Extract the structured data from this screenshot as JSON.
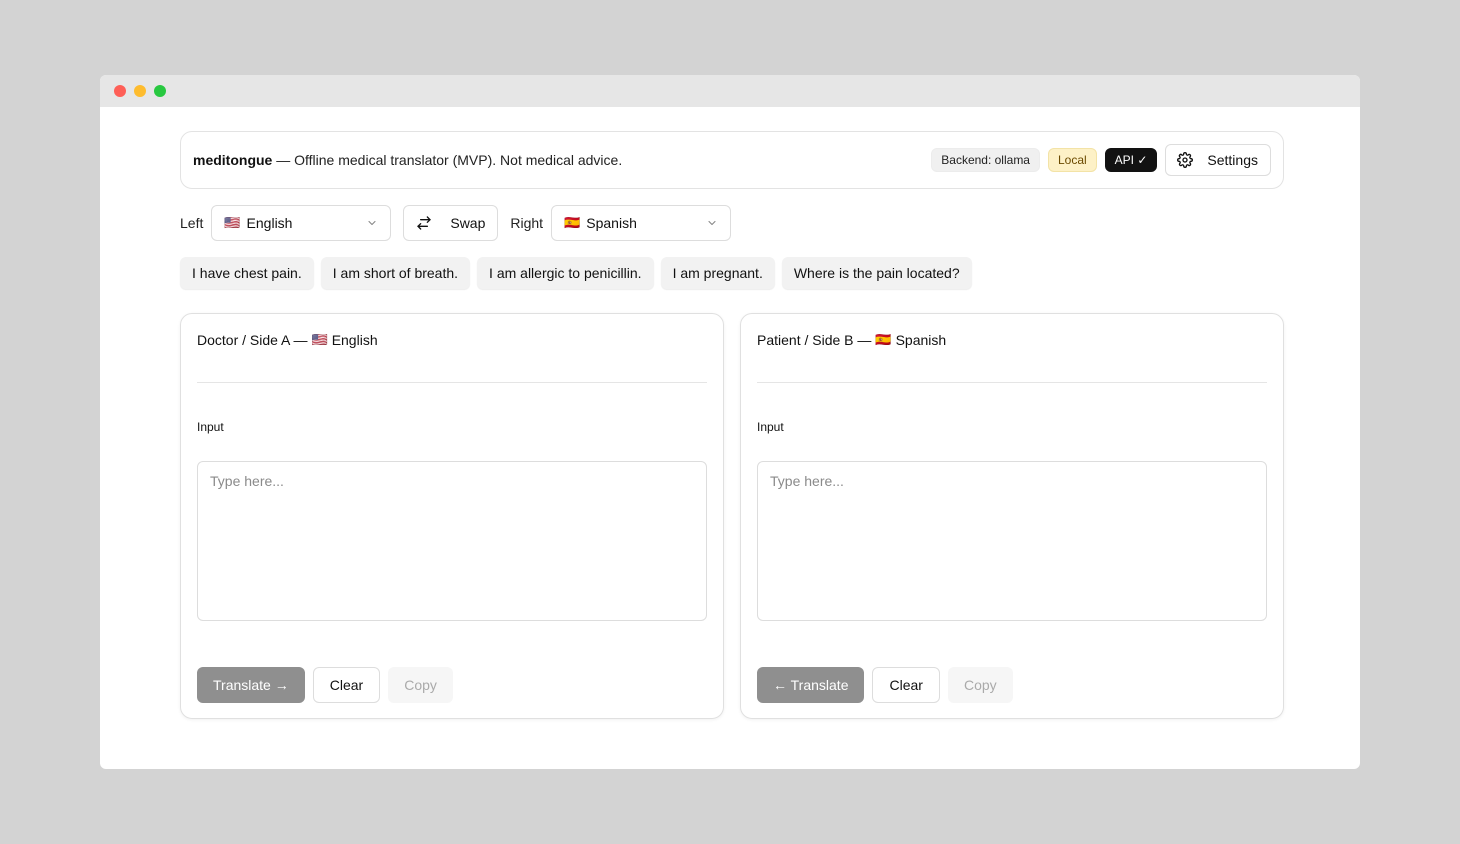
{
  "header": {
    "brand": "meditongue",
    "tagline": " — Offline medical translator (MVP). Not medical advice.",
    "badges": {
      "backend": "Backend: ollama",
      "local": "Local",
      "api": "API ✓"
    },
    "settings_label": "Settings"
  },
  "langbar": {
    "left_label": "Left",
    "left_flag": "🇺🇸",
    "left_language": "English",
    "swap_label": "Swap",
    "right_label": "Right",
    "right_flag": "🇪🇸",
    "right_language": "Spanish"
  },
  "phrases": [
    "I have chest pain.",
    "I am short of breath.",
    "I am allergic to penicillin.",
    "I am pregnant.",
    "Where is the pain located?"
  ],
  "panels": [
    {
      "title": "Doctor / Side A — ",
      "flag": "🇺🇸",
      "language": "English",
      "input_label": "Input",
      "placeholder": "Type here...",
      "translate_label": "Translate →",
      "clear_label": "Clear",
      "copy_label": "Copy"
    },
    {
      "title": "Patient / Side B — ",
      "flag": "🇪🇸",
      "language": "Spanish",
      "input_label": "Input",
      "placeholder": "Type here...",
      "translate_label": "← Translate",
      "clear_label": "Clear",
      "copy_label": "Copy"
    }
  ],
  "colors": {
    "accent_dark": "#121212",
    "local_badge": "#fdf1c7",
    "primary_button": "#8f8f8f"
  }
}
